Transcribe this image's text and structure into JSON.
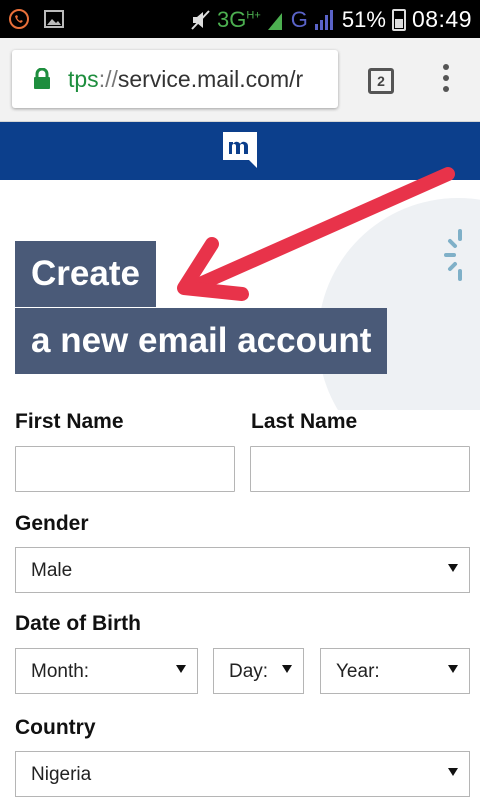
{
  "status_bar": {
    "network": "3G",
    "network_sup": "H+",
    "carrier_g": "G",
    "battery": "51%",
    "time": "08:49"
  },
  "browser": {
    "url_scheme": "tps",
    "url_sep": "://",
    "url_host": "service.mail.com/r",
    "tab_count": "2"
  },
  "hero": {
    "title_line1": "Create",
    "title_line2": "a new email account"
  },
  "form": {
    "first_name_label": "First Name",
    "last_name_label": "Last Name",
    "first_name_value": "",
    "last_name_value": "",
    "gender_label": "Gender",
    "gender_value": "Male",
    "dob_label": "Date of Birth",
    "month_value": "Month:",
    "day_value": "Day:",
    "year_value": "Year:",
    "country_label": "Country",
    "country_value": "Nigeria"
  },
  "colors": {
    "header_blue": "#0c3f8c",
    "title_bg": "#4a5a78",
    "annotation_arrow": "#e8334a",
    "secure_green": "#1e8e3e"
  }
}
